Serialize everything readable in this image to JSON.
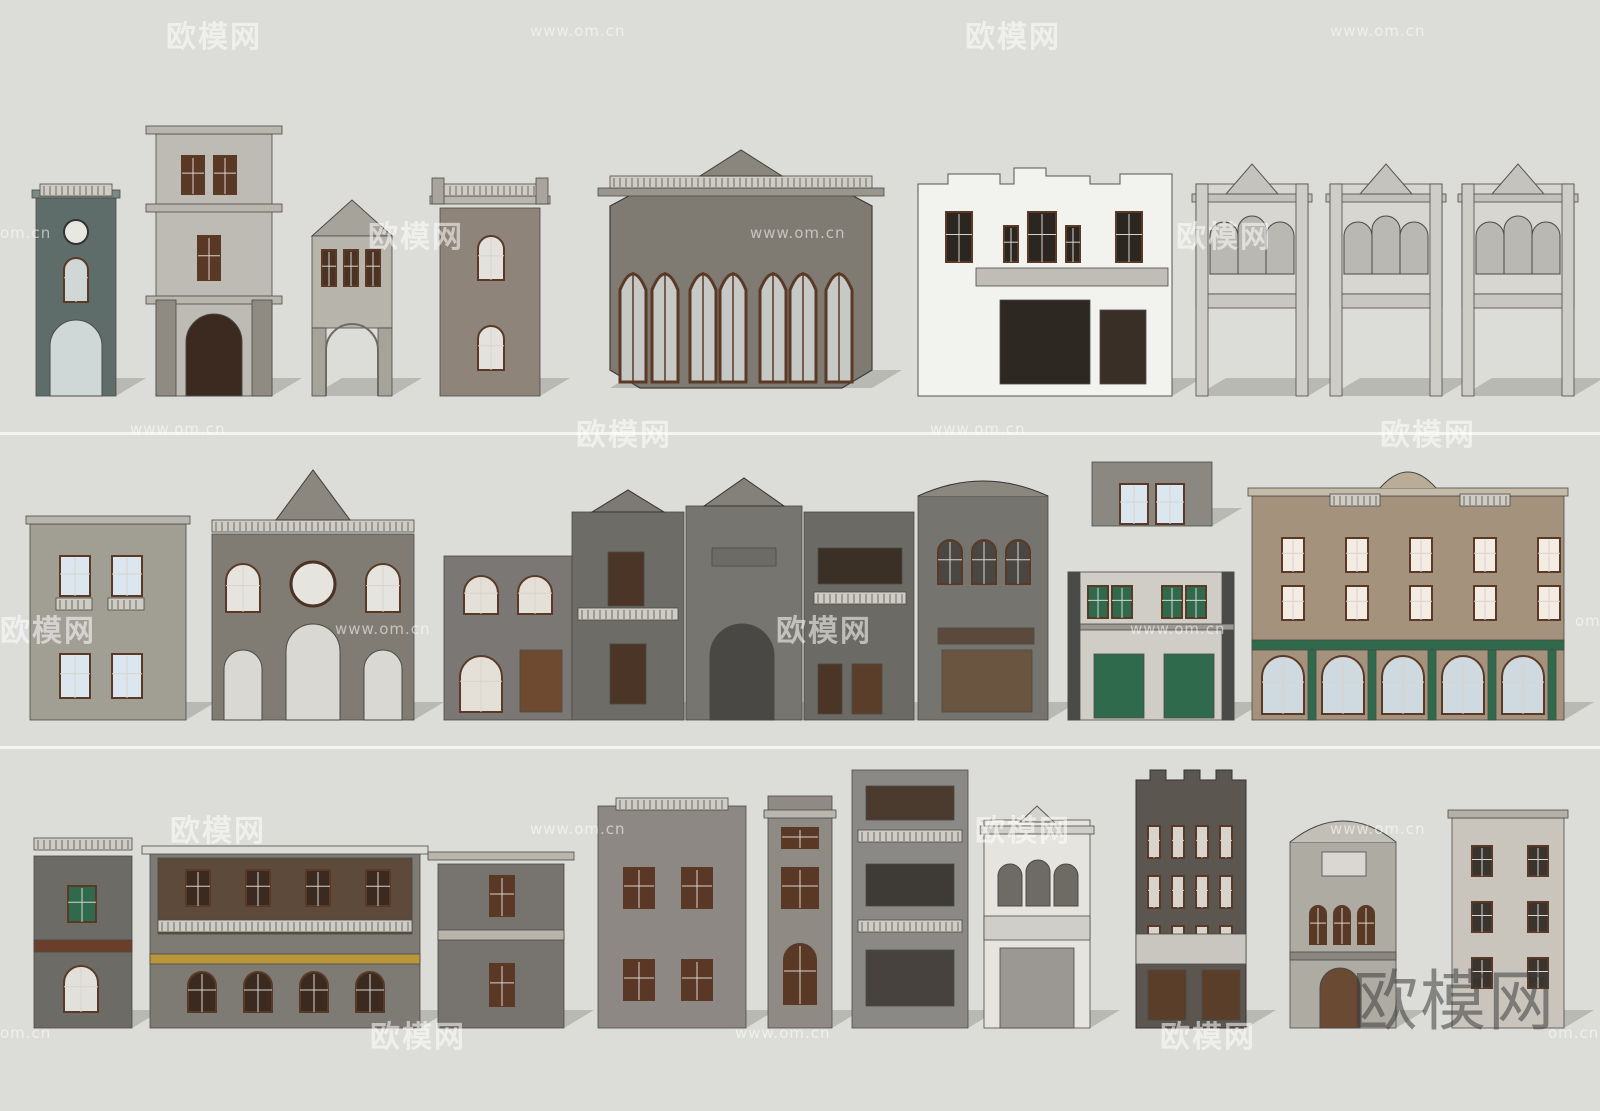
{
  "watermark": {
    "logo_text": "欧模网",
    "url_text": "www.om.cn",
    "url_fragment": "om.cn",
    "corner_logo": "欧模网"
  },
  "rows": [
    {
      "name": "row-1",
      "buildings": [
        "clock-tower",
        "tall-gate-tower",
        "arcade-pavilion",
        "brick-tower",
        "octagonal-gothic-pavilion",
        "white-stepped-facade",
        "arched-portico-1",
        "arched-portico-2",
        "arched-portico-3"
      ]
    },
    {
      "name": "row-2",
      "buildings": [
        "stone-villa",
        "clock-archway",
        "grouped-shop-street",
        "small-upper-block",
        "green-shutter-house",
        "grand-colonnade-building"
      ]
    },
    {
      "name": "row-3",
      "buildings": [
        "stone-corner-house",
        "balcony-longhouse",
        "brick-cube-house",
        "brick-mansion",
        "narrow-tower-house",
        "concrete-apartment",
        "white-arcade-house",
        "dark-crenellated-block",
        "ornate-shop-front",
        "office-facade"
      ]
    }
  ],
  "colors": {
    "background": "#dcdcd8",
    "divider": "#f4f4f2",
    "stone": "#8f8e86",
    "brick": "#7a7570",
    "window_frame": "#5a3a26",
    "glass": "#dbe6ef",
    "green_trim": "#2f6a4c"
  }
}
